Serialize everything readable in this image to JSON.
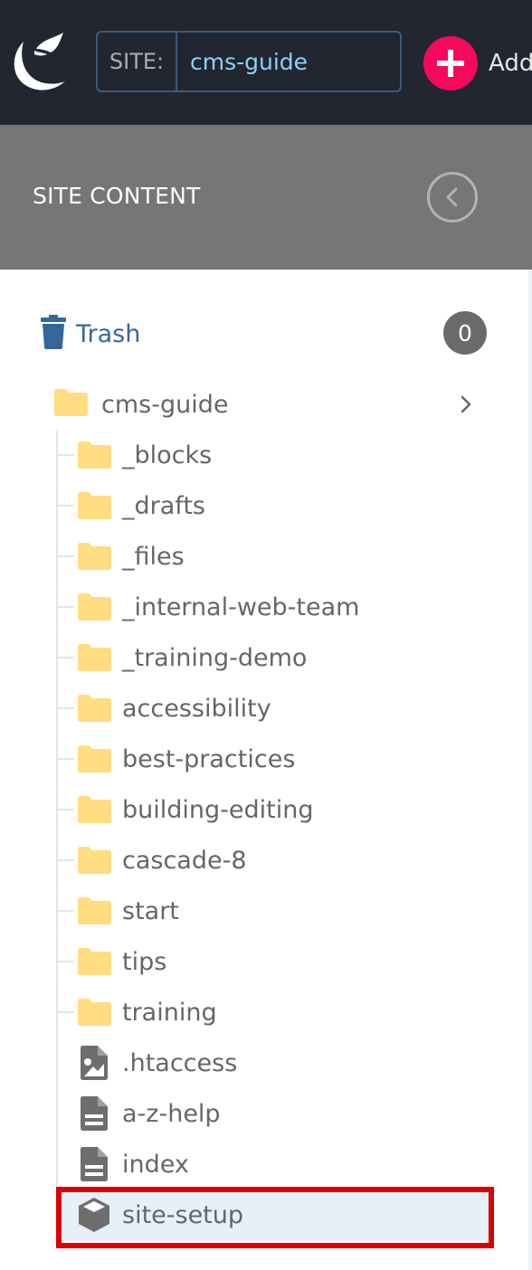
{
  "topbar": {
    "logo": "cascade-logo-icon",
    "site_label": "SITE:",
    "site_value": "cms-guide",
    "add_label": "Add",
    "add_icon": "plus-circle-icon",
    "colors": {
      "background": "#222631",
      "add_accent": "#f4095d",
      "site_value": "#8dd0f5"
    }
  },
  "panel": {
    "title": "SITE CONTENT",
    "collapse_icon": "chevron-left-circle-icon"
  },
  "trash": {
    "label": "Trash",
    "count": "0",
    "icon": "trash-icon",
    "color": "#36679a"
  },
  "tree": {
    "root": {
      "label": "cms-guide",
      "icon": "folder-icon",
      "expand_icon": "chevron-right-icon"
    },
    "children": [
      {
        "label": "_blocks",
        "type": "folder"
      },
      {
        "label": "_drafts",
        "type": "folder"
      },
      {
        "label": "_files",
        "type": "folder"
      },
      {
        "label": "_internal-web-team",
        "type": "folder"
      },
      {
        "label": "_training-demo",
        "type": "folder"
      },
      {
        "label": "accessibility",
        "type": "folder"
      },
      {
        "label": "best-practices",
        "type": "folder"
      },
      {
        "label": "building-editing",
        "type": "folder"
      },
      {
        "label": "cascade-8",
        "type": "folder"
      },
      {
        "label": "start",
        "type": "folder"
      },
      {
        "label": "tips",
        "type": "folder"
      },
      {
        "label": "training",
        "type": "folder"
      },
      {
        "label": ".htaccess",
        "type": "file-image"
      },
      {
        "label": "a-z-help",
        "type": "page"
      },
      {
        "label": "index",
        "type": "page"
      },
      {
        "label": "site-setup",
        "type": "block",
        "selected": true
      }
    ],
    "colors": {
      "folder": "#ffdd80",
      "file": "#6e6e6e",
      "selected_bg": "#e6f0f9",
      "highlight_outline": "#dd0000"
    }
  }
}
